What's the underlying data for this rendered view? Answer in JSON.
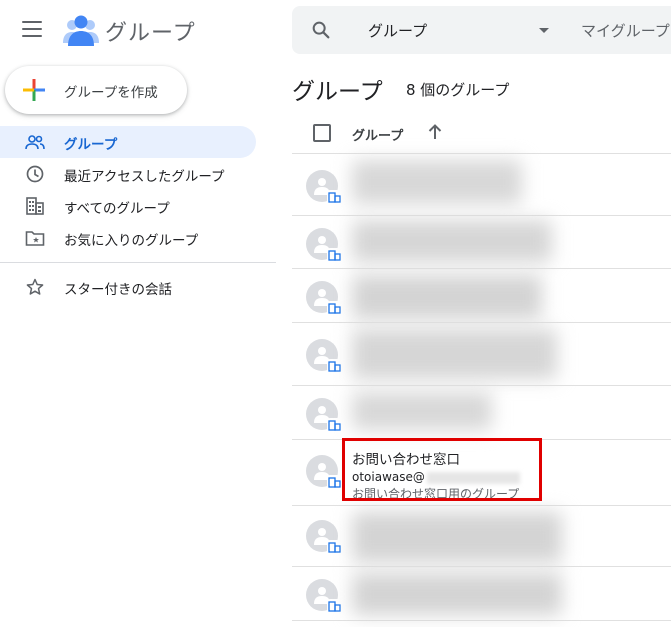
{
  "header": {
    "app_title": "グループ",
    "search_scope": "グループ",
    "search_secondary": "マイグループ"
  },
  "sidebar": {
    "create_label": "グループを作成",
    "items": [
      {
        "label": "グループ",
        "icon": "people-icon",
        "active": true
      },
      {
        "label": "最近アクセスしたグループ",
        "icon": "clock-icon",
        "active": false
      },
      {
        "label": "すべてのグループ",
        "icon": "building-icon",
        "active": false
      },
      {
        "label": "お気に入りのグループ",
        "icon": "star-folder-icon",
        "active": false
      },
      {
        "label": "スター付きの会話",
        "icon": "star-icon",
        "active": false
      }
    ]
  },
  "main": {
    "title": "グループ",
    "count_label": "8 個のグループ",
    "column_header": "グループ",
    "sort": "ascending",
    "visible_group": {
      "name": "お問い合わせ窓口",
      "email_prefix": "otoiawase@",
      "description": "お問い合わせ窓口用のグループ"
    }
  },
  "colors": {
    "accent": "#1967d2",
    "active_bg": "#e8f0fe",
    "highlight": "#e00000",
    "logo_blue": "#4285f4"
  }
}
